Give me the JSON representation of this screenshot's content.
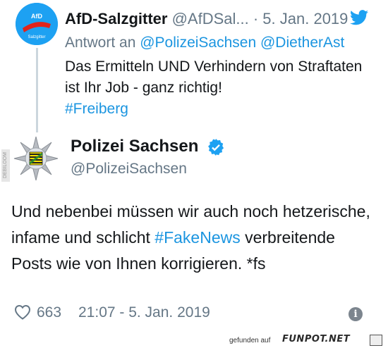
{
  "reply_tweet": {
    "name": "AfD-Salzgitter",
    "handle": "@AfDSal...",
    "separator": "·",
    "date": "5. Jan. 2019",
    "reply_prefix": "Antwort an",
    "mentions": [
      "@PolizeiSachsen",
      "@DietherAst"
    ],
    "text": "Das Ermitteln UND Verhindern von Straftaten ist Ihr Job - ganz richtig!",
    "hashtag": "#Freiberg",
    "avatar_text_top": "AfD",
    "avatar_text_bottom": "Salzgitter"
  },
  "main_tweet": {
    "name": "Polizei Sachsen",
    "handle": "@PolizeiSachsen",
    "text_part1": "Und nebenbei müssen wir auch noch hetzerische, infame und schlicht",
    "hashtag": "#FakeNews",
    "text_part2": "verbreitende Posts wie von Ihnen korrigieren. *fs",
    "like_count": "663",
    "timestamp": "21:07 - 5. Jan. 2019"
  },
  "watermark": {
    "prefix": "gefunden auf",
    "site": "FUNPOT.NET",
    "side_tag": "DEBILOOM"
  },
  "colors": {
    "link": "#1b95e0",
    "twitter_blue": "#1da1f2",
    "secondary_text": "#657786",
    "thread_line": "#ccd6dd"
  }
}
